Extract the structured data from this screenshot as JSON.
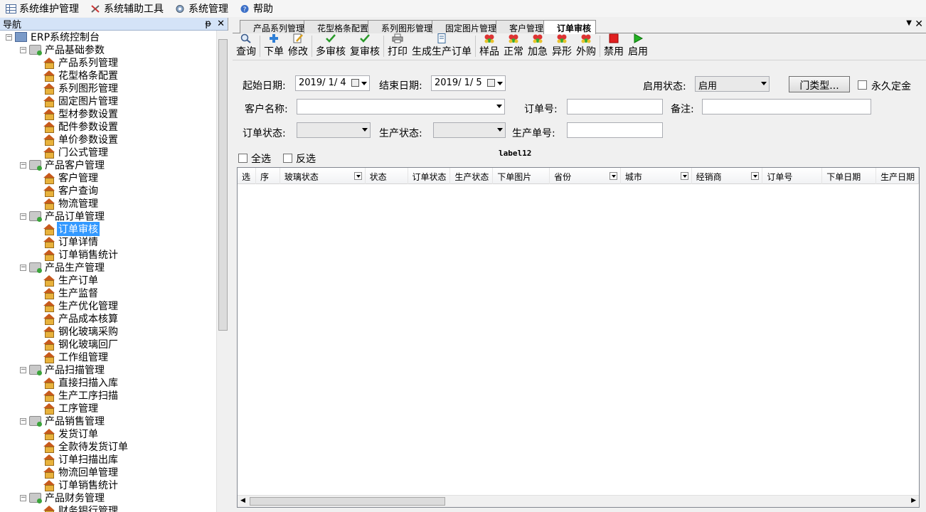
{
  "menu": [
    {
      "label": "系统维护管理",
      "icon": "table-icon"
    },
    {
      "label": "系统辅助工具",
      "icon": "tools-icon"
    },
    {
      "label": "系统管理",
      "icon": "gear-icon"
    },
    {
      "label": "帮助",
      "icon": "help-icon"
    }
  ],
  "nav": {
    "title": "导航",
    "pin": "ᵽ",
    "close": "✕",
    "root": "ERP系统控制台",
    "groups": [
      {
        "label": "产品基础参数",
        "items": [
          "产品系列管理",
          "花型格条配置",
          "系列图形管理",
          "固定图片管理",
          "型材参数设置",
          "配件参数设置",
          "单价参数设置",
          "门公式管理"
        ]
      },
      {
        "label": "产品客户管理",
        "items": [
          "客户管理",
          "客户查询",
          "物流管理"
        ]
      },
      {
        "label": "产品订单管理",
        "items": [
          "订单审核",
          "订单详情",
          "订单销售统计"
        ]
      },
      {
        "label": "产品生产管理",
        "items": [
          "生产订单",
          "生产监督",
          "生产优化管理",
          "产品成本核算",
          "钢化玻璃采购",
          "钢化玻璃回厂",
          "工作组管理"
        ]
      },
      {
        "label": "产品扫描管理",
        "items": [
          "直接扫描入库",
          "生产工序扫描",
          "工序管理"
        ]
      },
      {
        "label": "产品销售管理",
        "items": [
          "发货订单",
          "全款待发货订单",
          "订单扫描出库",
          "物流回单管理",
          "订单销售统计"
        ]
      },
      {
        "label": "产品财务管理",
        "items": [
          "财务银行管理"
        ]
      }
    ],
    "selected": "订单审核"
  },
  "tabs": [
    "产品系列管理",
    "花型格条配置",
    "系列图形管理",
    "固定图片管理",
    "客户管理",
    "订单审核"
  ],
  "active_tab": "订单审核",
  "toolbar": [
    {
      "label": "查询",
      "icon": "search-icon"
    },
    {
      "label": "下单",
      "icon": "plus-icon"
    },
    {
      "label": "修改",
      "icon": "edit-icon"
    },
    {
      "label": "多审核",
      "icon": "check-icon"
    },
    {
      "label": "复审核",
      "icon": "check-icon"
    },
    {
      "label": "打印",
      "icon": "printer-icon"
    },
    {
      "label": "生成生产订单",
      "icon": "document-icon"
    },
    {
      "label": "样品",
      "icon": "hearts-icon"
    },
    {
      "label": "正常",
      "icon": "hearts-icon"
    },
    {
      "label": "加急",
      "icon": "hearts-icon"
    },
    {
      "label": "异形",
      "icon": "hearts-icon"
    },
    {
      "label": "外购",
      "icon": "hearts-icon"
    },
    {
      "label": "禁用",
      "icon": "stop-icon"
    },
    {
      "label": "启用",
      "icon": "play-icon"
    }
  ],
  "filters": {
    "start_date_label": "起始日期:",
    "start_date": "2019/ 1/ 4",
    "end_date_label": "结束日期:",
    "end_date": "2019/ 1/ 5",
    "enable_status_label": "启用状态:",
    "enable_status": "启用",
    "door_type_button": "门类型...",
    "permanent_deposit": "永久定金",
    "customer_label": "客户名称:",
    "customer": "",
    "order_no_label": "订单号:",
    "order_no": "",
    "remark_label": "备注:",
    "remark": "",
    "order_status_label": "订单状态:",
    "order_status": "",
    "production_status_label": "生产状态:",
    "production_status": "",
    "production_no_label": "生产单号:",
    "production_no": "",
    "select_all": "全选",
    "invert": "反选",
    "label12": "label12"
  },
  "grid": {
    "columns": [
      "选",
      "序",
      "玻璃状态",
      "状态",
      "订单状态",
      "生产状态",
      "下单图片",
      "省份",
      "城市",
      "经销商",
      "订单号",
      "下单日期",
      "生产日期"
    ]
  }
}
